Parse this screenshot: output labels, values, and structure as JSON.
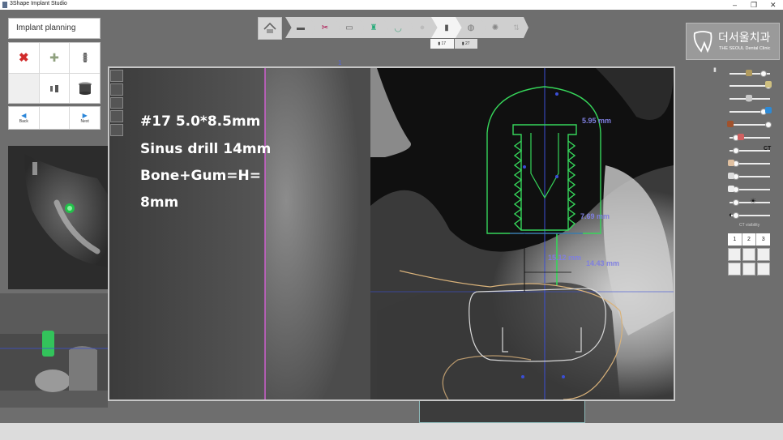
{
  "window": {
    "title": "3Shape Implant Studio",
    "buttons": {
      "minimize": "–",
      "maximize": "❐",
      "close": "✕"
    }
  },
  "left_panel": {
    "title": "Implant planning",
    "tools": [
      {
        "icon": "delete-x-icon",
        "glyph": "✖",
        "color": "#d12b2b"
      },
      {
        "icon": "add-plus-icon",
        "glyph": "✚",
        "color": "#8a9b7a"
      },
      {
        "icon": "implant-icon",
        "glyph": "▮",
        "color": "#666666"
      },
      {
        "icon": "blank-tool",
        "glyph": "",
        "color": "#ffffff"
      },
      {
        "icon": "abutment-icon",
        "glyph": "▮▮",
        "color": "#666666"
      },
      {
        "icon": "sleeve-icon",
        "glyph": "▆",
        "color": "#444444"
      }
    ],
    "nav": {
      "back": "Back",
      "next": "Next"
    }
  },
  "toolbar": {
    "home_icon": "home-icon",
    "steps": [
      "scan-icon",
      "drill-icon",
      "crop-icon",
      "segment-icon",
      "arch-icon",
      "crown-icon",
      "implant-icon",
      "sleeve-icon",
      "guide-icon",
      "export-icon"
    ],
    "tooth_tabs": [
      "17",
      "27"
    ]
  },
  "logo": {
    "korean": "더서울치과",
    "english": "THE SEOUL Dental Clinic"
  },
  "right_panel": {
    "ct_label": "CT",
    "ct_visibility": "CT visibility",
    "layouts": [
      "1",
      "2",
      "3"
    ]
  },
  "viewport": {
    "axis_marker": "1",
    "notes": [
      "#17 5.0*8.5mm",
      "Sinus drill 14mm",
      "Bone+Gum=H=",
      "8mm"
    ],
    "measurements": [
      "5.95 mm",
      "7.69 mm",
      "15.12 mm",
      "14.43 mm"
    ]
  },
  "colors": {
    "implant_outline": "#36d65a",
    "axis_line": "#3b4fd6",
    "nerve_line": "#d9b27a",
    "guide_line": "#cf5fcf"
  }
}
